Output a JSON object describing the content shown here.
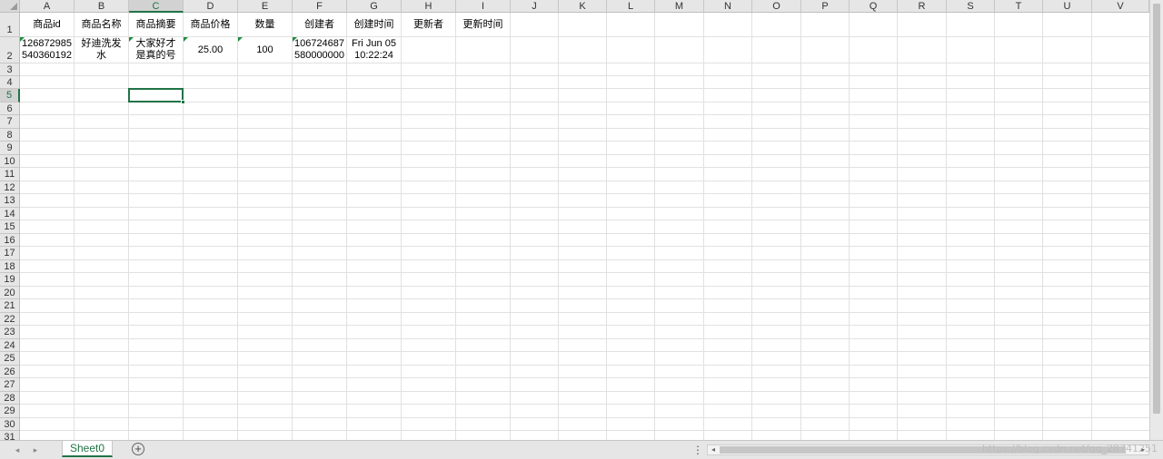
{
  "columns": [
    "A",
    "B",
    "C",
    "D",
    "E",
    "F",
    "G",
    "H",
    "I",
    "J",
    "K",
    "L",
    "M",
    "N",
    "O",
    "P",
    "Q",
    "R",
    "S",
    "T",
    "U",
    "V"
  ],
  "rows": [
    "1",
    "2",
    "3",
    "4",
    "5",
    "6",
    "7",
    "8",
    "9",
    "10",
    "11",
    "12",
    "13",
    "14",
    "15",
    "16",
    "17",
    "18",
    "19",
    "20",
    "21",
    "22",
    "23",
    "24",
    "25",
    "26",
    "27",
    "28",
    "29",
    "30",
    "31"
  ],
  "selected_cell": "C5",
  "header_row": [
    "商品id",
    "商品名称",
    "商品摘要",
    "商品价格",
    "数量",
    "创建者",
    "创建时间",
    "更新者",
    "更新时间"
  ],
  "data_row": [
    "126872985\n540360192",
    "好迪洗发\n水",
    "大家好才\n是真的号",
    "25.00",
    "100",
    "106724687\n580000000",
    "Fri Jun 05\n10:22:24",
    "",
    ""
  ],
  "text_format_flags": [
    true,
    false,
    true,
    true,
    true,
    true,
    false,
    false,
    false
  ],
  "sheet_tab": "Sheet0",
  "add_sheet_label": "+",
  "watermark": "https://blog.csdn.net/qq_28741251",
  "colors": {
    "accent": "#217346",
    "grid": "#e1e1e1",
    "header_bg": "#e6e6e6",
    "text_flag": "#1e8e3e"
  }
}
